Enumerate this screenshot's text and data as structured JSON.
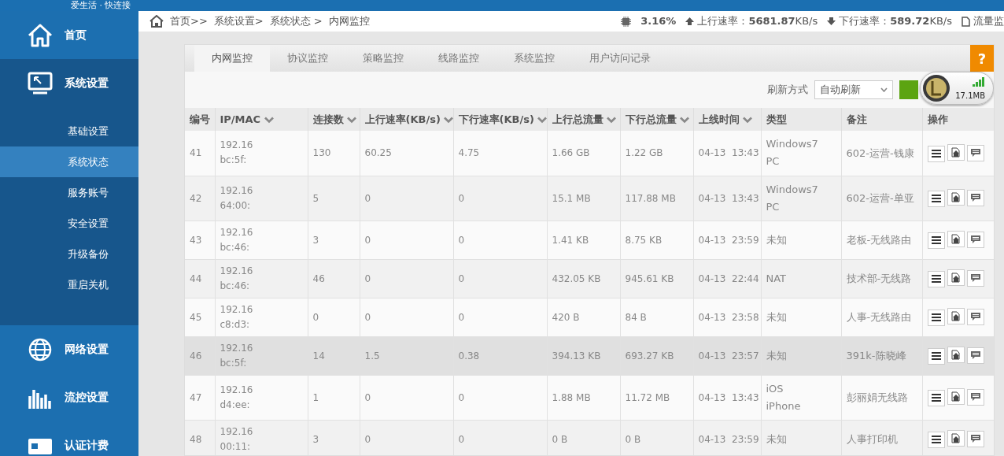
{
  "top_bar": {
    "slogan": "爱生活 · 快连接"
  },
  "sidebar": {
    "items": [
      {
        "label": "首页",
        "selected": false
      },
      {
        "label": "系统设置",
        "selected": true,
        "children": [
          {
            "label": "基础设置",
            "selected": false
          },
          {
            "label": "系统状态",
            "selected": true
          },
          {
            "label": "服务账号",
            "selected": false
          },
          {
            "label": "安全设置",
            "selected": false
          },
          {
            "label": "升级备份",
            "selected": false
          },
          {
            "label": "重启关机",
            "selected": false
          }
        ]
      },
      {
        "label": "网络设置",
        "selected": false
      },
      {
        "label": "流控设置",
        "selected": false
      },
      {
        "label": "认证计费",
        "selected": false
      }
    ]
  },
  "breadcrumb": [
    "首页>>",
    "系统设置>",
    "系统状态 >",
    "内网监控"
  ],
  "stats": {
    "cpu": "3.16%",
    "up_label": "上行速率：",
    "up_value": "5681.87",
    "up_unit": "KB/s",
    "down_label": "下行速率：",
    "down_value": "589.72",
    "down_unit": "KB/s",
    "traffic_label": "流量监"
  },
  "tabs": [
    {
      "label": "内网监控",
      "selected": true
    },
    {
      "label": "协议监控",
      "selected": false
    },
    {
      "label": "策略监控",
      "selected": false
    },
    {
      "label": "线路监控",
      "selected": false
    },
    {
      "label": "系统监控",
      "selected": false
    },
    {
      "label": "用户访问记录",
      "selected": false
    }
  ],
  "help_button": "?",
  "refresh": {
    "label": "刷新方式",
    "value": "自动刷新"
  },
  "float_widget": {
    "reading": "17.1MB"
  },
  "table": {
    "columns": [
      {
        "label": "编号",
        "sortable": false
      },
      {
        "label": "IP/MAC",
        "sortable": true
      },
      {
        "label": "连接数",
        "sortable": true
      },
      {
        "label": "上行速率(KB/s)",
        "sortable": true
      },
      {
        "label": "下行速率(KB/s)",
        "sortable": true
      },
      {
        "label": "上行总流量",
        "sortable": true
      },
      {
        "label": "下行总流量",
        "sortable": true
      },
      {
        "label": "上线时间",
        "sortable": true
      },
      {
        "label": "类型",
        "sortable": false
      },
      {
        "label": "备注",
        "sortable": false
      },
      {
        "label": "操作",
        "sortable": false
      }
    ],
    "rows": [
      {
        "id": "41",
        "ip": "192.16",
        "mac": "bc:5f:",
        "conns": "130",
        "up_rate": "60.25",
        "down_rate": "4.75",
        "up_total": "1.66 GB",
        "down_total": "1.22 GB",
        "date": "04-13",
        "time": "13:43",
        "type": [
          "Windows7",
          "PC"
        ],
        "note": "602-运营-钱康",
        "selected": false
      },
      {
        "id": "42",
        "ip": "192.16",
        "mac": "64:00:",
        "conns": "5",
        "up_rate": "0",
        "down_rate": "0",
        "up_total": "15.1 MB",
        "down_total": "117.88 MB",
        "date": "04-13",
        "time": "13:43",
        "type": [
          "Windows7",
          "PC"
        ],
        "note": "602-运营-单亚",
        "selected": false
      },
      {
        "id": "43",
        "ip": "192.16",
        "mac": "bc:46:",
        "conns": "3",
        "up_rate": "0",
        "down_rate": "0",
        "up_total": "1.41 KB",
        "down_total": "8.75 KB",
        "date": "04-13",
        "time": "23:59",
        "type": [
          "未知"
        ],
        "note": "老板-无线路由",
        "selected": false
      },
      {
        "id": "44",
        "ip": "192.16",
        "mac": "bc:46:",
        "conns": "46",
        "up_rate": "0",
        "down_rate": "0",
        "up_total": "432.05 KB",
        "down_total": "945.61 KB",
        "date": "04-13",
        "time": "22:44",
        "type": [
          "NAT"
        ],
        "note": "技术部-无线路",
        "selected": false
      },
      {
        "id": "45",
        "ip": "192.16",
        "mac": "c8:d3:",
        "conns": "0",
        "up_rate": "0",
        "down_rate": "0",
        "up_total": "420 B",
        "down_total": "84 B",
        "date": "04-13",
        "time": "23:58",
        "type": [
          "未知"
        ],
        "note": "人事-无线路由",
        "selected": false
      },
      {
        "id": "46",
        "ip": "192.16",
        "mac": "bc:5f:",
        "conns": "14",
        "up_rate": "1.5",
        "down_rate": "0.38",
        "up_total": "394.13 KB",
        "down_total": "693.27 KB",
        "date": "04-13",
        "time": "23:57",
        "type": [
          "未知"
        ],
        "note": "391k-陈晓峰",
        "selected": true
      },
      {
        "id": "47",
        "ip": "192.16",
        "mac": "d4:ee:",
        "conns": "1",
        "up_rate": "0",
        "down_rate": "0",
        "up_total": "1.88 MB",
        "down_total": "11.72 MB",
        "date": "04-13",
        "time": "13:43",
        "type": [
          "iOS",
          "iPhone"
        ],
        "note": "彭丽娟无线路",
        "selected": false
      },
      {
        "id": "48",
        "ip": "192.16",
        "mac": "00:11:",
        "conns": "3",
        "up_rate": "0",
        "down_rate": "0",
        "up_total": "0 B",
        "down_total": "0 B",
        "date": "04-13",
        "time": "23:59",
        "type": [
          "未知"
        ],
        "note": "人事打印机",
        "selected": false
      }
    ]
  }
}
